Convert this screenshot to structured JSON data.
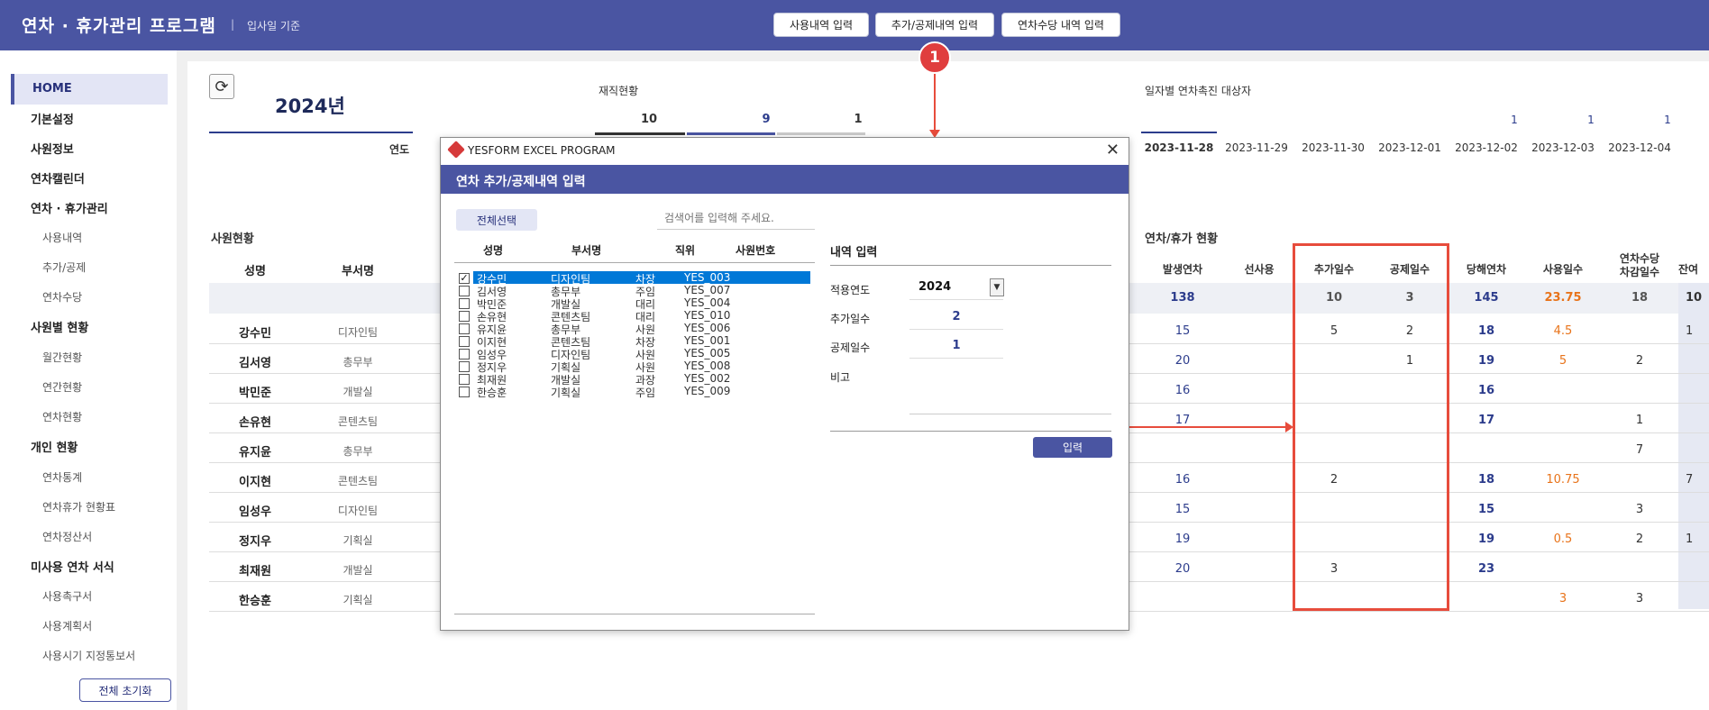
{
  "header": {
    "title": "연차 · 휴가관리 프로그램",
    "separator": "|",
    "subtitle": "입사일 기준",
    "buttons": [
      "사용내역 입력",
      "추가/공제내역 입력",
      "연차수당 내역 입력"
    ]
  },
  "sidebar": {
    "home": "HOME",
    "items": [
      {
        "label": "기본설정"
      },
      {
        "label": "사원정보"
      },
      {
        "label": "연차캘린더"
      },
      {
        "label": "연차 · 휴가관리"
      },
      {
        "label": "사용내역"
      },
      {
        "label": "추가/공제"
      },
      {
        "label": "연차수당"
      },
      {
        "label": "사원별 현황"
      },
      {
        "label": "월간현황"
      },
      {
        "label": "연간현황"
      },
      {
        "label": "연차현황"
      },
      {
        "label": "개인 현황"
      },
      {
        "label": "연차통계"
      },
      {
        "label": "연차휴가 현황표"
      },
      {
        "label": "연차정산서"
      },
      {
        "label": "미사용 연차 서식"
      },
      {
        "label": "사용촉구서"
      },
      {
        "label": "사용계획서"
      },
      {
        "label": "사용시기 지정통보서"
      }
    ],
    "reset_label": "전체 초기화"
  },
  "dashboard": {
    "year": "2024년",
    "year_label": "연도",
    "employment_title": "재직현황",
    "employment_counts": [
      "10",
      "9",
      "1"
    ],
    "promotion_title": "일자별 연차촉진 대상자",
    "promotion_counts": [
      "1",
      "1",
      "1"
    ],
    "dates": [
      "2023-11-28",
      "2023-11-29",
      "2023-11-30",
      "2023-12-01",
      "2023-12-02",
      "2023-12-03",
      "2023-12-04"
    ],
    "staff_title": "사원현황",
    "leave_title": "연차/휴가 현황",
    "col_name": "성명",
    "col_dept": "부서명",
    "leave_cols": [
      "발생연차",
      "선사용",
      "추가일수",
      "공제일수",
      "당해연차",
      "사용일수",
      "연차수당\n차감일수",
      "잔여"
    ],
    "totals": [
      "138",
      "",
      "10",
      "3",
      "145",
      "23.75",
      "18",
      "10"
    ],
    "employees": [
      {
        "name": "강수민",
        "dept": "디자인팀",
        "vals": [
          "15",
          "",
          "5",
          "2",
          "18",
          "4.5",
          "",
          "1"
        ]
      },
      {
        "name": "김서영",
        "dept": "총무부",
        "vals": [
          "20",
          "",
          "",
          "1",
          "19",
          "5",
          "2",
          ""
        ]
      },
      {
        "name": "박민준",
        "dept": "개발실",
        "vals": [
          "16",
          "",
          "",
          "",
          "16",
          "",
          "",
          ""
        ]
      },
      {
        "name": "손유현",
        "dept": "콘텐츠팀",
        "vals": [
          "17",
          "",
          "",
          "",
          "17",
          "",
          "1",
          ""
        ]
      },
      {
        "name": "유지윤",
        "dept": "총무부",
        "vals": [
          "",
          "",
          "",
          "",
          "",
          "",
          "7",
          ""
        ]
      },
      {
        "name": "이지현",
        "dept": "콘텐츠팀",
        "vals": [
          "16",
          "",
          "2",
          "",
          "18",
          "10.75",
          "",
          "7"
        ]
      },
      {
        "name": "임성우",
        "dept": "디자인팀",
        "vals": [
          "15",
          "",
          "",
          "",
          "15",
          "",
          "3",
          ""
        ]
      },
      {
        "name": "정지우",
        "dept": "기획실",
        "vals": [
          "19",
          "",
          "",
          "",
          "19",
          "0.5",
          "2",
          "1"
        ]
      },
      {
        "name": "최재원",
        "dept": "개발실",
        "vals": [
          "20",
          "",
          "3",
          "",
          "23",
          "",
          "",
          ""
        ]
      },
      {
        "name": "한승훈",
        "dept": "기획실",
        "vals": [
          "",
          "",
          "",
          "",
          "",
          "3",
          "3",
          ""
        ]
      }
    ]
  },
  "annotation": {
    "badge": "1"
  },
  "dialog": {
    "window_title": "YESFORM EXCEL PROGRAM",
    "close": "✕",
    "header": "연차 추가/공제내역 입력",
    "select_all": "전체선택",
    "search_placeholder": "검색어를 입력해 주세요.",
    "columns": [
      "성명",
      "부서명",
      "직위",
      "사원번호"
    ],
    "rows": [
      {
        "name": "강수민",
        "dept": "디자인팀",
        "pos": "차장",
        "id": "YES_003",
        "checked": "✓"
      },
      {
        "name": "김서영",
        "dept": "총무부",
        "pos": "주임",
        "id": "YES_007",
        "checked": ""
      },
      {
        "name": "박민준",
        "dept": "개발실",
        "pos": "대리",
        "id": "YES_004",
        "checked": ""
      },
      {
        "name": "손유현",
        "dept": "콘텐츠팀",
        "pos": "대리",
        "id": "YES_010",
        "checked": ""
      },
      {
        "name": "유지윤",
        "dept": "총무부",
        "pos": "사원",
        "id": "YES_006",
        "checked": ""
      },
      {
        "name": "이지현",
        "dept": "콘텐츠팀",
        "pos": "차장",
        "id": "YES_001",
        "checked": ""
      },
      {
        "name": "임성우",
        "dept": "디자인팀",
        "pos": "사원",
        "id": "YES_005",
        "checked": ""
      },
      {
        "name": "정지우",
        "dept": "기획실",
        "pos": "사원",
        "id": "YES_008",
        "checked": ""
      },
      {
        "name": "최재원",
        "dept": "개발실",
        "pos": "과장",
        "id": "YES_002",
        "checked": ""
      },
      {
        "name": "한승훈",
        "dept": "기획실",
        "pos": "주임",
        "id": "YES_009",
        "checked": ""
      }
    ],
    "section_title": "내역 입력",
    "labels": {
      "year": "적용연도",
      "add": "추가일수",
      "deduct": "공제일수",
      "note": "비고"
    },
    "values": {
      "year": "2024",
      "add": "2",
      "deduct": "1",
      "note": ""
    },
    "dropdown_arrow": "▼",
    "submit": "입력"
  }
}
